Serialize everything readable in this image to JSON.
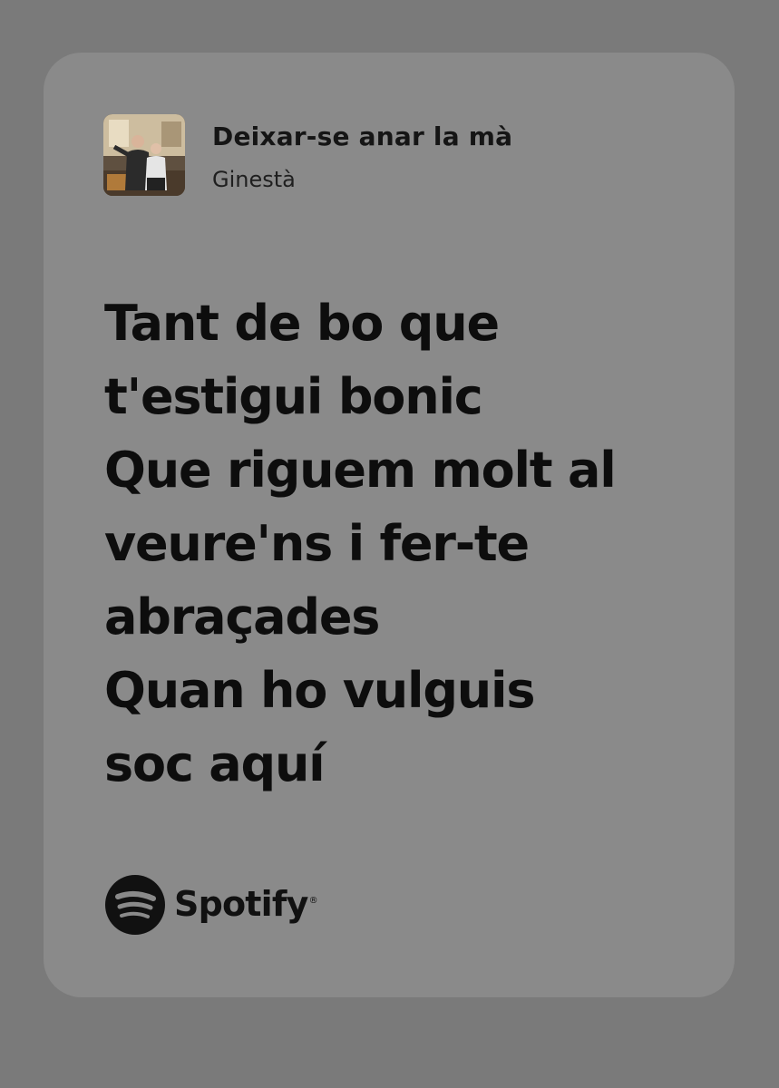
{
  "track": {
    "title": "Deixar-se anar la mà",
    "artist": "Ginestà",
    "cover_icon": "album-cover-photo"
  },
  "lyrics": {
    "lines": [
      "Tant de bo que",
      "t'estigui bonic",
      "Que riguem molt al",
      "veure'ns i fer-te",
      "abraçades",
      "Quan ho vulguis",
      "soc aquí"
    ]
  },
  "brand": {
    "name": "Spotify",
    "registered": "®",
    "icon": "spotify-logo-icon"
  },
  "colors": {
    "background": "#7a7a7a",
    "card": "#8a8a8a",
    "text": "#0d0d0d"
  }
}
